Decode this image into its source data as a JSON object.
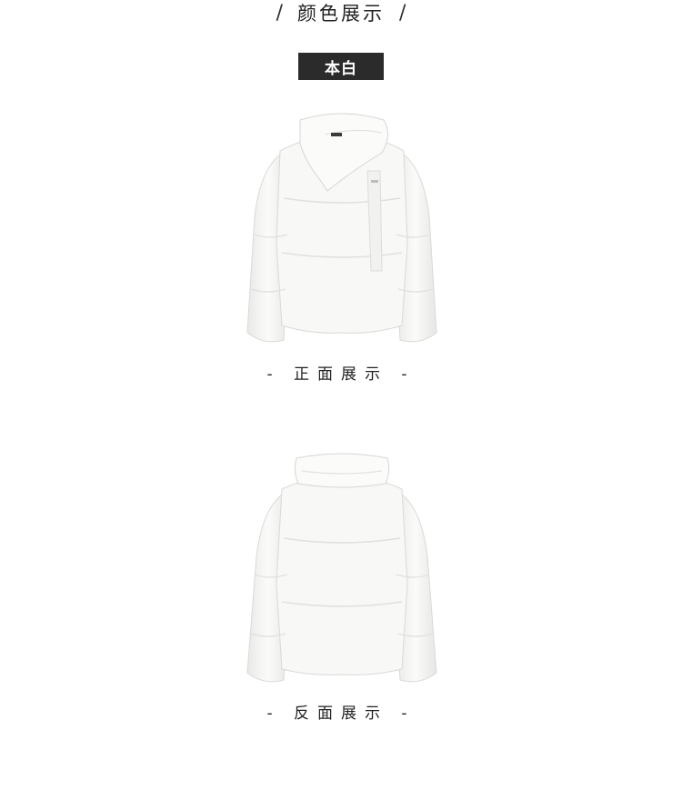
{
  "header": {
    "slash_left": "/",
    "title": "颜色展示",
    "slash_right": "/"
  },
  "color_badge": {
    "label": "本白",
    "background": "#2b2b2b"
  },
  "front": {
    "caption": "- 正面展示 -"
  },
  "back": {
    "caption": "- 反面展示 -"
  }
}
